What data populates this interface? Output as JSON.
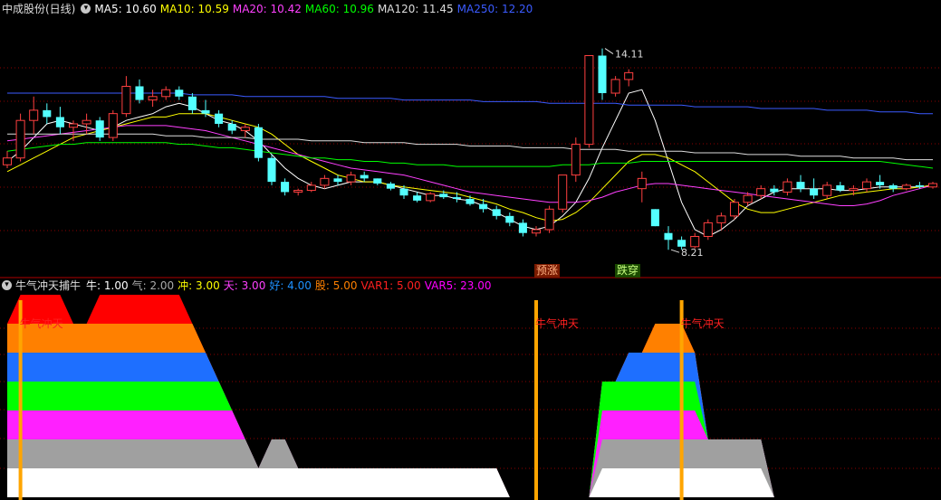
{
  "header": {
    "title": "中成股份(日线)",
    "menu_icon": "chevron-down-icon",
    "indicators": [
      {
        "label": "MA5: 10.60",
        "color": "#ffffff"
      },
      {
        "label": "MA10: 10.59",
        "color": "#ffff00"
      },
      {
        "label": "MA20: 10.42",
        "color": "#ff40ff"
      },
      {
        "label": "MA60: 10.96",
        "color": "#00ff00"
      },
      {
        "label": "MA120: 11.45",
        "color": "#dddddd"
      },
      {
        "label": "MA250: 12.20",
        "color": "#3b5bff"
      }
    ]
  },
  "sub_header": {
    "title": "牛气冲天捕牛",
    "menu_icon": "chevron-down-icon",
    "indicators": [
      {
        "label": "牛: 1.00",
        "color": "#ffffff"
      },
      {
        "label": "气: 2.00",
        "color": "#aaaaaa"
      },
      {
        "label": "冲: 3.00",
        "color": "#ffff00"
      },
      {
        "label": "天: 3.00",
        "color": "#ff40ff"
      },
      {
        "label": "好: 4.00",
        "color": "#1e90ff"
      },
      {
        "label": "股: 5.00",
        "color": "#ff8000"
      },
      {
        "label": "VAR1: 5.00",
        "color": "#ff2020"
      },
      {
        "label": "VAR5: 23.00",
        "color": "#ff00ff"
      }
    ]
  },
  "annotations": {
    "high_label": "14.11",
    "low_label": "8.21",
    "signal_up": "预涨",
    "signal_down": "跌穿",
    "bull_signal": "牛气冲天"
  },
  "colors": {
    "up": "#ff4040",
    "down": "#54ffff",
    "grid": "#8b0000",
    "separator": "#b00000",
    "band_layers": [
      "#ffffff",
      "#a0a0a0",
      "#ff20ff",
      "#00ff00",
      "#1e6fff",
      "#ff8000",
      "#ff0000"
    ],
    "signal_bar": "#ffa500"
  },
  "chart_data": [
    {
      "type": "candlestick",
      "title": "中成股份(日线)",
      "ylim": [
        7.5,
        15
      ],
      "grid": "dotted horizontal",
      "candles": [
        [
          10.7,
          11.1,
          10.6,
          10.9
        ],
        [
          10.9,
          12.2,
          10.8,
          12.0
        ],
        [
          12.0,
          12.7,
          11.6,
          12.3
        ],
        [
          12.3,
          12.5,
          11.9,
          12.1
        ],
        [
          12.1,
          12.4,
          11.6,
          11.8
        ],
        [
          11.8,
          12.0,
          11.4,
          11.9
        ],
        [
          11.9,
          12.2,
          11.6,
          12.0
        ],
        [
          12.0,
          12.1,
          11.4,
          11.5
        ],
        [
          11.5,
          12.3,
          11.4,
          12.2
        ],
        [
          12.2,
          13.3,
          12.1,
          13.0
        ],
        [
          13.0,
          13.2,
          12.5,
          12.6
        ],
        [
          12.6,
          12.9,
          12.4,
          12.7
        ],
        [
          12.7,
          13.0,
          12.6,
          12.9
        ],
        [
          12.9,
          13.0,
          12.6,
          12.7
        ],
        [
          12.7,
          12.8,
          12.2,
          12.3
        ],
        [
          12.3,
          12.6,
          12.1,
          12.2
        ],
        [
          12.2,
          12.3,
          11.8,
          11.9
        ],
        [
          11.9,
          12.0,
          11.6,
          11.7
        ],
        [
          11.7,
          11.9,
          11.5,
          11.8
        ],
        [
          11.8,
          11.9,
          10.8,
          10.9
        ],
        [
          10.9,
          11.0,
          10.1,
          10.2
        ],
        [
          10.2,
          10.3,
          9.8,
          9.9
        ],
        [
          9.9,
          10.0,
          9.8,
          9.95
        ],
        [
          9.95,
          10.2,
          9.9,
          10.1
        ],
        [
          10.1,
          10.4,
          10.0,
          10.3
        ],
        [
          10.3,
          10.4,
          10.1,
          10.2
        ],
        [
          10.2,
          10.5,
          10.1,
          10.4
        ],
        [
          10.4,
          10.5,
          10.2,
          10.3
        ],
        [
          10.3,
          10.3,
          10.1,
          10.15
        ],
        [
          10.15,
          10.2,
          9.95,
          10.0
        ],
        [
          10.0,
          10.1,
          9.7,
          9.8
        ],
        [
          9.8,
          9.9,
          9.6,
          9.65
        ],
        [
          9.65,
          9.9,
          9.6,
          9.85
        ],
        [
          9.85,
          9.95,
          9.7,
          9.75
        ],
        [
          9.75,
          9.9,
          9.6,
          9.7
        ],
        [
          9.7,
          9.8,
          9.5,
          9.55
        ],
        [
          9.55,
          9.7,
          9.3,
          9.4
        ],
        [
          9.4,
          9.5,
          9.1,
          9.2
        ],
        [
          9.2,
          9.3,
          8.9,
          9.0
        ],
        [
          9.0,
          9.1,
          8.6,
          8.7
        ],
        [
          8.7,
          8.9,
          8.6,
          8.8
        ],
        [
          8.8,
          9.5,
          8.7,
          9.4
        ],
        [
          9.4,
          10.4,
          9.3,
          10.4
        ],
        [
          10.4,
          11.5,
          10.2,
          11.3
        ],
        [
          11.3,
          13.9,
          11.2,
          13.9
        ],
        [
          13.9,
          14.11,
          12.6,
          12.8
        ],
        [
          12.8,
          13.3,
          12.7,
          13.2
        ],
        [
          13.2,
          13.5,
          13.0,
          13.4
        ],
        [
          10.0,
          10.5,
          9.6,
          10.3
        ],
        [
          9.4,
          9.4,
          8.9,
          8.9
        ],
        [
          8.7,
          8.9,
          8.21,
          8.5
        ],
        [
          8.5,
          8.6,
          8.21,
          8.3
        ],
        [
          8.3,
          8.7,
          8.25,
          8.6
        ],
        [
          8.6,
          9.1,
          8.5,
          9.0
        ],
        [
          9.0,
          9.3,
          8.8,
          9.2
        ],
        [
          9.2,
          9.7,
          9.1,
          9.6
        ],
        [
          9.6,
          9.9,
          9.5,
          9.8
        ],
        [
          9.8,
          10.1,
          9.7,
          10.0
        ],
        [
          10.0,
          10.1,
          9.8,
          9.9
        ],
        [
          9.9,
          10.3,
          9.8,
          10.2
        ],
        [
          10.2,
          10.4,
          9.9,
          10.0
        ],
        [
          10.0,
          10.3,
          9.7,
          9.8
        ],
        [
          9.8,
          10.2,
          9.7,
          10.1
        ],
        [
          10.1,
          10.2,
          9.9,
          9.95
        ],
        [
          9.95,
          10.1,
          9.8,
          10.0
        ],
        [
          10.0,
          10.3,
          9.9,
          10.2
        ],
        [
          10.2,
          10.4,
          10.0,
          10.1
        ],
        [
          10.1,
          10.15,
          9.9,
          10.0
        ],
        [
          10.0,
          10.15,
          9.95,
          10.1
        ],
        [
          10.1,
          10.2,
          10.0,
          10.05
        ],
        [
          10.05,
          10.2,
          10.0,
          10.15
        ]
      ],
      "moving_averages": {
        "MA5": [
          10.8,
          11.1,
          11.5,
          11.9,
          12.0,
          11.9,
          11.8,
          11.7,
          11.8,
          12.0,
          12.1,
          12.2,
          12.4,
          12.5,
          12.4,
          12.2,
          12.0,
          11.9,
          11.7,
          11.4,
          11.0,
          10.6,
          10.3,
          10.1,
          10.0,
          10.1,
          10.2,
          10.2,
          10.2,
          10.1,
          10.0,
          9.9,
          9.8,
          9.8,
          9.7,
          9.65,
          9.5,
          9.3,
          9.1,
          8.9,
          8.8,
          8.9,
          9.2,
          9.6,
          10.3,
          11.2,
          12.0,
          12.8,
          12.9,
          12.0,
          10.8,
          9.6,
          8.8,
          8.6,
          8.8,
          9.1,
          9.5,
          9.7,
          9.9,
          10.0,
          10.0,
          10.0,
          10.0,
          9.95,
          9.95,
          10.0,
          10.05,
          10.05,
          10.05,
          10.05,
          10.1
        ],
        "MA10": [
          10.5,
          10.7,
          10.9,
          11.1,
          11.3,
          11.5,
          11.6,
          11.7,
          11.8,
          11.9,
          12.0,
          12.1,
          12.1,
          12.2,
          12.2,
          12.2,
          12.1,
          12.0,
          11.9,
          11.8,
          11.6,
          11.3,
          11.0,
          10.8,
          10.6,
          10.4,
          10.3,
          10.2,
          10.2,
          10.1,
          10.05,
          10.0,
          9.95,
          9.9,
          9.85,
          9.75,
          9.65,
          9.55,
          9.4,
          9.3,
          9.15,
          9.05,
          9.1,
          9.3,
          9.6,
          10.0,
          10.4,
          10.8,
          11.0,
          11.0,
          10.9,
          10.7,
          10.5,
          10.2,
          9.9,
          9.6,
          9.4,
          9.3,
          9.3,
          9.4,
          9.5,
          9.6,
          9.7,
          9.8,
          9.85,
          9.9,
          9.95,
          10.0,
          10.0,
          10.05,
          10.1
        ],
        "MA20": [
          11.4,
          11.45,
          11.5,
          11.55,
          11.6,
          11.65,
          11.7,
          11.75,
          11.8,
          11.85,
          11.85,
          11.85,
          11.85,
          11.8,
          11.75,
          11.7,
          11.6,
          11.5,
          11.4,
          11.3,
          11.2,
          11.1,
          11.0,
          10.9,
          10.8,
          10.7,
          10.6,
          10.55,
          10.5,
          10.45,
          10.4,
          10.3,
          10.2,
          10.1,
          10.0,
          9.9,
          9.85,
          9.8,
          9.75,
          9.7,
          9.65,
          9.6,
          9.6,
          9.6,
          9.65,
          9.75,
          9.9,
          10.0,
          10.1,
          10.15,
          10.15,
          10.1,
          10.05,
          10.0,
          9.95,
          9.9,
          9.85,
          9.8,
          9.75,
          9.7,
          9.65,
          9.6,
          9.55,
          9.5,
          9.5,
          9.55,
          9.65,
          9.8,
          9.9,
          10.0,
          10.1
        ],
        "MA60": [
          11.1,
          11.15,
          11.2,
          11.25,
          11.3,
          11.3,
          11.35,
          11.35,
          11.35,
          11.35,
          11.35,
          11.35,
          11.35,
          11.3,
          11.3,
          11.25,
          11.2,
          11.2,
          11.15,
          11.1,
          11.05,
          11.0,
          10.95,
          10.9,
          10.9,
          10.85,
          10.85,
          10.8,
          10.8,
          10.75,
          10.75,
          10.7,
          10.7,
          10.7,
          10.65,
          10.65,
          10.65,
          10.65,
          10.65,
          10.65,
          10.65,
          10.65,
          10.7,
          10.7,
          10.7,
          10.75,
          10.75,
          10.75,
          10.8,
          10.8,
          10.8,
          10.8,
          10.8,
          10.8,
          10.8,
          10.8,
          10.8,
          10.8,
          10.8,
          10.8,
          10.8,
          10.8,
          10.8,
          10.8,
          10.8,
          10.8,
          10.8,
          10.75,
          10.7,
          10.65,
          10.6
        ],
        "MA120": [
          11.6,
          11.6,
          11.6,
          11.6,
          11.6,
          11.6,
          11.6,
          11.6,
          11.6,
          11.6,
          11.6,
          11.6,
          11.55,
          11.55,
          11.55,
          11.5,
          11.5,
          11.5,
          11.5,
          11.45,
          11.45,
          11.45,
          11.45,
          11.4,
          11.4,
          11.4,
          11.4,
          11.35,
          11.35,
          11.35,
          11.35,
          11.3,
          11.3,
          11.3,
          11.3,
          11.25,
          11.25,
          11.25,
          11.25,
          11.2,
          11.2,
          11.2,
          11.2,
          11.15,
          11.15,
          11.15,
          11.15,
          11.1,
          11.1,
          11.1,
          11.1,
          11.1,
          11.05,
          11.05,
          11.05,
          11.05,
          11.0,
          11.0,
          11.0,
          11.0,
          10.95,
          10.95,
          10.95,
          10.95,
          10.9,
          10.9,
          10.9,
          10.9,
          10.85,
          10.85,
          10.85
        ],
        "MA250": [
          12.8,
          12.8,
          12.8,
          12.8,
          12.8,
          12.8,
          12.8,
          12.8,
          12.8,
          12.8,
          12.8,
          12.8,
          12.8,
          12.8,
          12.75,
          12.75,
          12.75,
          12.75,
          12.7,
          12.7,
          12.7,
          12.7,
          12.7,
          12.7,
          12.7,
          12.65,
          12.65,
          12.65,
          12.65,
          12.65,
          12.6,
          12.6,
          12.6,
          12.6,
          12.6,
          12.6,
          12.55,
          12.55,
          12.55,
          12.55,
          12.55,
          12.5,
          12.5,
          12.5,
          12.5,
          12.5,
          12.5,
          12.45,
          12.45,
          12.45,
          12.45,
          12.45,
          12.4,
          12.4,
          12.4,
          12.4,
          12.4,
          12.35,
          12.35,
          12.35,
          12.35,
          12.35,
          12.3,
          12.3,
          12.3,
          12.3,
          12.25,
          12.25,
          12.25,
          12.2,
          12.2
        ]
      }
    },
    {
      "type": "area",
      "title": "牛气冲天捕牛",
      "ylim": [
        0,
        7
      ],
      "note": "stacked band indicator, level per bar 0-7",
      "levels": [
        6,
        7,
        7,
        7,
        7,
        6,
        6,
        7,
        7,
        7,
        7,
        7,
        7,
        7,
        6,
        5,
        4,
        3,
        2,
        1,
        2,
        2,
        1,
        1,
        1,
        1,
        1,
        1,
        1,
        1,
        1,
        1,
        1,
        1,
        1,
        1,
        1,
        1,
        0,
        0,
        0,
        0,
        0,
        0,
        0,
        4,
        4,
        5,
        5,
        6,
        6,
        6,
        5,
        2,
        2,
        2,
        2,
        2,
        0,
        0,
        0,
        0,
        0,
        0,
        0,
        0,
        0,
        0,
        0,
        0,
        0
      ],
      "signal_bars": [
        1,
        40,
        51
      ],
      "series": [
        {
          "name": "牛",
          "value": 1.0
        },
        {
          "name": "气",
          "value": 2.0
        },
        {
          "name": "冲",
          "value": 3.0
        },
        {
          "name": "天",
          "value": 3.0
        },
        {
          "name": "好",
          "value": 4.0
        },
        {
          "name": "股",
          "value": 5.0
        },
        {
          "name": "VAR1",
          "value": 5.0
        },
        {
          "name": "VAR5",
          "value": 23.0
        }
      ]
    }
  ]
}
